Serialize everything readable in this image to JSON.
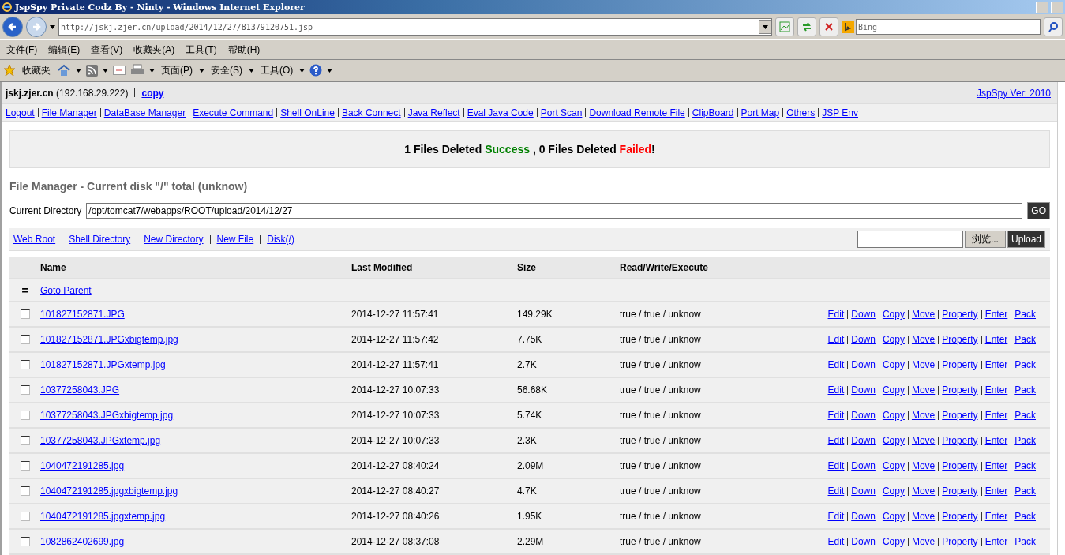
{
  "window": {
    "title": "JspSpy Private Codz By - Ninty - Windows Internet Explorer"
  },
  "address_bar": {
    "url": "http://jskj.zjer.cn/upload/2014/12/27/81379120751.jsp"
  },
  "search": {
    "placeholder": "Bing"
  },
  "menu_bar": [
    "文件(F)",
    "编辑(E)",
    "查看(V)",
    "收藏夹(A)",
    "工具(T)",
    "帮助(H)"
  ],
  "favorites_bar": {
    "favorites": "收藏夹",
    "menus": [
      "页面(P)",
      "安全(S)",
      "工具(O)"
    ]
  },
  "header": {
    "host": "jskj.zjer.cn",
    "ip": "(192.168.29.222)",
    "copy_link": "copy",
    "version_link": "JspSpy Ver: 2010"
  },
  "nav_links": [
    "Logout",
    "File Manager",
    "DataBase Manager",
    "Execute Command",
    "Shell OnLine",
    "Back Connect",
    "Java Reflect",
    "Eval Java Code",
    "Port Scan",
    "Download Remote File",
    "ClipBoard",
    "Port Map",
    "Others",
    "JSP Env"
  ],
  "message": [
    {
      "kind": "plain",
      "text": "1 Files Deleted "
    },
    {
      "kind": "success",
      "text": "Success"
    },
    {
      "kind": "plain",
      "text": " , 0 Files Deleted "
    },
    {
      "kind": "failed",
      "text": "Failed"
    },
    {
      "kind": "plain",
      "text": "!"
    }
  ],
  "file_manager": {
    "title": "File Manager - Current disk \"/\" total (unknow)",
    "directory_label": "Current Directory",
    "directory": "/opt/tomcat7/webapps/ROOT/upload/2014/12/27",
    "go_button": "GO",
    "links": [
      "Web Root",
      "Shell Directory",
      "New Directory",
      "New File",
      "Disk(/)"
    ],
    "browse_button": "浏览...",
    "upload_button": "Upload"
  },
  "table": {
    "columns": [
      "Name",
      "Last Modified",
      "Size",
      "Read/Write/Execute"
    ],
    "parent": {
      "icon": "=",
      "link": "Goto Parent"
    },
    "rows": [
      {
        "checked": false,
        "name": "101827152871.JPG",
        "modified": "2014-12-27 11:57:41",
        "size": "149.29K",
        "rwx": "true / true / unknow",
        "actions": [
          "Edit",
          "Down",
          "Copy",
          "Move",
          "Property",
          "Enter",
          "Pack"
        ]
      },
      {
        "checked": false,
        "name": "101827152871.JPGxbigtemp.jpg",
        "modified": "2014-12-27 11:57:42",
        "size": "7.75K",
        "rwx": "true / true / unknow",
        "actions": [
          "Edit",
          "Down",
          "Copy",
          "Move",
          "Property",
          "Enter",
          "Pack"
        ]
      },
      {
        "checked": false,
        "name": "101827152871.JPGxtemp.jpg",
        "modified": "2014-12-27 11:57:41",
        "size": "2.7K",
        "rwx": "true / true / unknow",
        "actions": [
          "Edit",
          "Down",
          "Copy",
          "Move",
          "Property",
          "Enter",
          "Pack"
        ]
      },
      {
        "checked": false,
        "name": "10377258043.JPG",
        "modified": "2014-12-27 10:07:33",
        "size": "56.68K",
        "rwx": "true / true / unknow",
        "actions": [
          "Edit",
          "Down",
          "Copy",
          "Move",
          "Property",
          "Enter",
          "Pack"
        ]
      },
      {
        "checked": false,
        "name": "10377258043.JPGxbigtemp.jpg",
        "modified": "2014-12-27 10:07:33",
        "size": "5.74K",
        "rwx": "true / true / unknow",
        "actions": [
          "Edit",
          "Down",
          "Copy",
          "Move",
          "Property",
          "Enter",
          "Pack"
        ]
      },
      {
        "checked": false,
        "name": "10377258043.JPGxtemp.jpg",
        "modified": "2014-12-27 10:07:33",
        "size": "2.3K",
        "rwx": "true / true / unknow",
        "actions": [
          "Edit",
          "Down",
          "Copy",
          "Move",
          "Property",
          "Enter",
          "Pack"
        ]
      },
      {
        "checked": false,
        "name": "1040472191285.jpg",
        "modified": "2014-12-27 08:40:24",
        "size": "2.09M",
        "rwx": "true / true / unknow",
        "actions": [
          "Edit",
          "Down",
          "Copy",
          "Move",
          "Property",
          "Enter",
          "Pack"
        ]
      },
      {
        "checked": false,
        "name": "1040472191285.jpgxbigtemp.jpg",
        "modified": "2014-12-27 08:40:27",
        "size": "4.7K",
        "rwx": "true / true / unknow",
        "actions": [
          "Edit",
          "Down",
          "Copy",
          "Move",
          "Property",
          "Enter",
          "Pack"
        ]
      },
      {
        "checked": false,
        "name": "1040472191285.jpgxtemp.jpg",
        "modified": "2014-12-27 08:40:26",
        "size": "1.95K",
        "rwx": "true / true / unknow",
        "actions": [
          "Edit",
          "Down",
          "Copy",
          "Move",
          "Property",
          "Enter",
          "Pack"
        ]
      },
      {
        "checked": false,
        "name": "1082862402699.jpg",
        "modified": "2014-12-27 08:37:08",
        "size": "2.29M",
        "rwx": "true / true / unknow",
        "actions": [
          "Edit",
          "Down",
          "Copy",
          "Move",
          "Property",
          "Enter",
          "Pack"
        ]
      }
    ]
  }
}
